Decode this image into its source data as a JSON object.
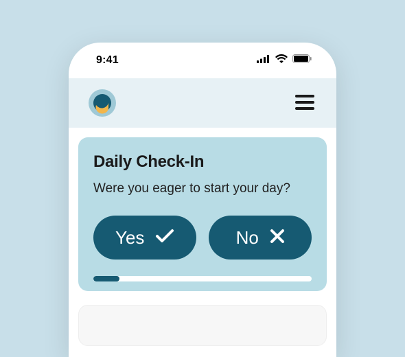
{
  "status_bar": {
    "time": "9:41"
  },
  "checkin": {
    "title": "Daily Check-In",
    "question": "Were you eager to start your day?",
    "yes_label": "Yes",
    "no_label": "No",
    "progress_percent": 12
  },
  "colors": {
    "page_bg": "#c8dfe9",
    "card_bg": "#b8dce5",
    "header_bg": "#e7f1f5",
    "accent": "#165a72"
  }
}
